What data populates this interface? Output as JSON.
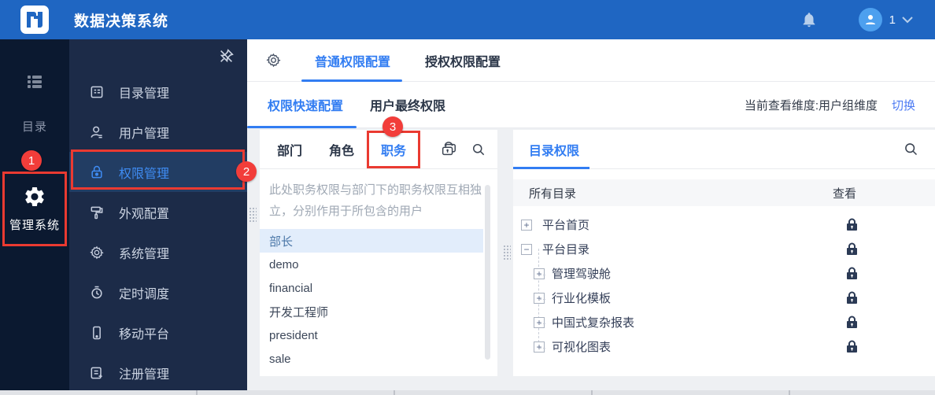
{
  "colors": {
    "topbar_blue": "#1f66c2",
    "sidebar_primary": "#0b1930",
    "sidebar_secondary": "#1c2b48",
    "active_blue": "#327df2",
    "annotation_red": "#ea3a31",
    "selected_item_bg": "#e2edfb"
  },
  "topbar": {
    "title": "数据决策系统",
    "user_count": "1",
    "icons": [
      "app-logo",
      "bell-icon",
      "user-avatar-icon",
      "chevron-down-icon"
    ]
  },
  "sidebar_primary": {
    "items": [
      {
        "label": "目录",
        "icon": "directory-menu-icon"
      },
      {
        "label": "管理系统",
        "icon": "gear-icon"
      }
    ],
    "annotation_badge": "1"
  },
  "sidebar_secondary": {
    "pin_icon": "unpin-icon",
    "items": [
      {
        "label": "目录管理",
        "icon": "catalog-icon",
        "active": false
      },
      {
        "label": "用户管理",
        "icon": "user-icon",
        "active": false
      },
      {
        "label": "权限管理",
        "icon": "lock-icon",
        "active": true
      },
      {
        "label": "外观配置",
        "icon": "paint-roller-icon",
        "active": false
      },
      {
        "label": "系统管理",
        "icon": "gear-icon",
        "active": false
      },
      {
        "label": "定时调度",
        "icon": "timer-icon",
        "active": false
      },
      {
        "label": "移动平台",
        "icon": "mobile-icon",
        "active": false
      },
      {
        "label": "注册管理",
        "icon": "register-doc-icon",
        "active": false
      }
    ],
    "annotation_badge": "2"
  },
  "main": {
    "settings_icon": "gear-icon",
    "top_tabs": [
      {
        "label": "普通权限配置",
        "active": true
      },
      {
        "label": "授权权限配置",
        "active": false
      }
    ],
    "sub_tabs": [
      {
        "label": "权限快速配置",
        "active": true
      },
      {
        "label": "用户最终权限",
        "active": false
      }
    ],
    "dimension_label": "当前查看维度:用户组维度",
    "switch_link": "切换",
    "annotation_badge": "3"
  },
  "left_panel": {
    "tabs": [
      {
        "label": "部门",
        "active": false
      },
      {
        "label": "角色",
        "active": false
      },
      {
        "label": "职务",
        "active": true
      }
    ],
    "header_icons": [
      "batch-permission-icon",
      "search-icon"
    ],
    "hint": "此处职务权限与部门下的职务权限互相独立，分别作用于所包含的用户",
    "items": [
      {
        "label": "部长",
        "selected": true
      },
      {
        "label": "demo",
        "selected": false
      },
      {
        "label": "financial",
        "selected": false
      },
      {
        "label": "开发工程师",
        "selected": false
      },
      {
        "label": "president",
        "selected": false
      },
      {
        "label": "sale",
        "selected": false
      }
    ]
  },
  "right_panel": {
    "tab": "目录权限",
    "search_icon": "search-icon",
    "columns": {
      "directory": "所有目录",
      "view": "查看"
    },
    "tree": [
      {
        "label": "平台首页",
        "expand": "+",
        "level": 0,
        "view_icon": "lock-icon"
      },
      {
        "label": "平台目录",
        "expand": "−",
        "level": 0,
        "view_icon": "lock-icon"
      },
      {
        "label": "管理驾驶舱",
        "expand": "+",
        "level": 1,
        "view_icon": "lock-icon"
      },
      {
        "label": "行业化模板",
        "expand": "+",
        "level": 1,
        "view_icon": "lock-icon"
      },
      {
        "label": "中国式复杂报表",
        "expand": "+",
        "level": 1,
        "view_icon": "lock-icon"
      },
      {
        "label": "可视化图表",
        "expand": "+",
        "level": 1,
        "view_icon": "lock-icon"
      }
    ]
  }
}
